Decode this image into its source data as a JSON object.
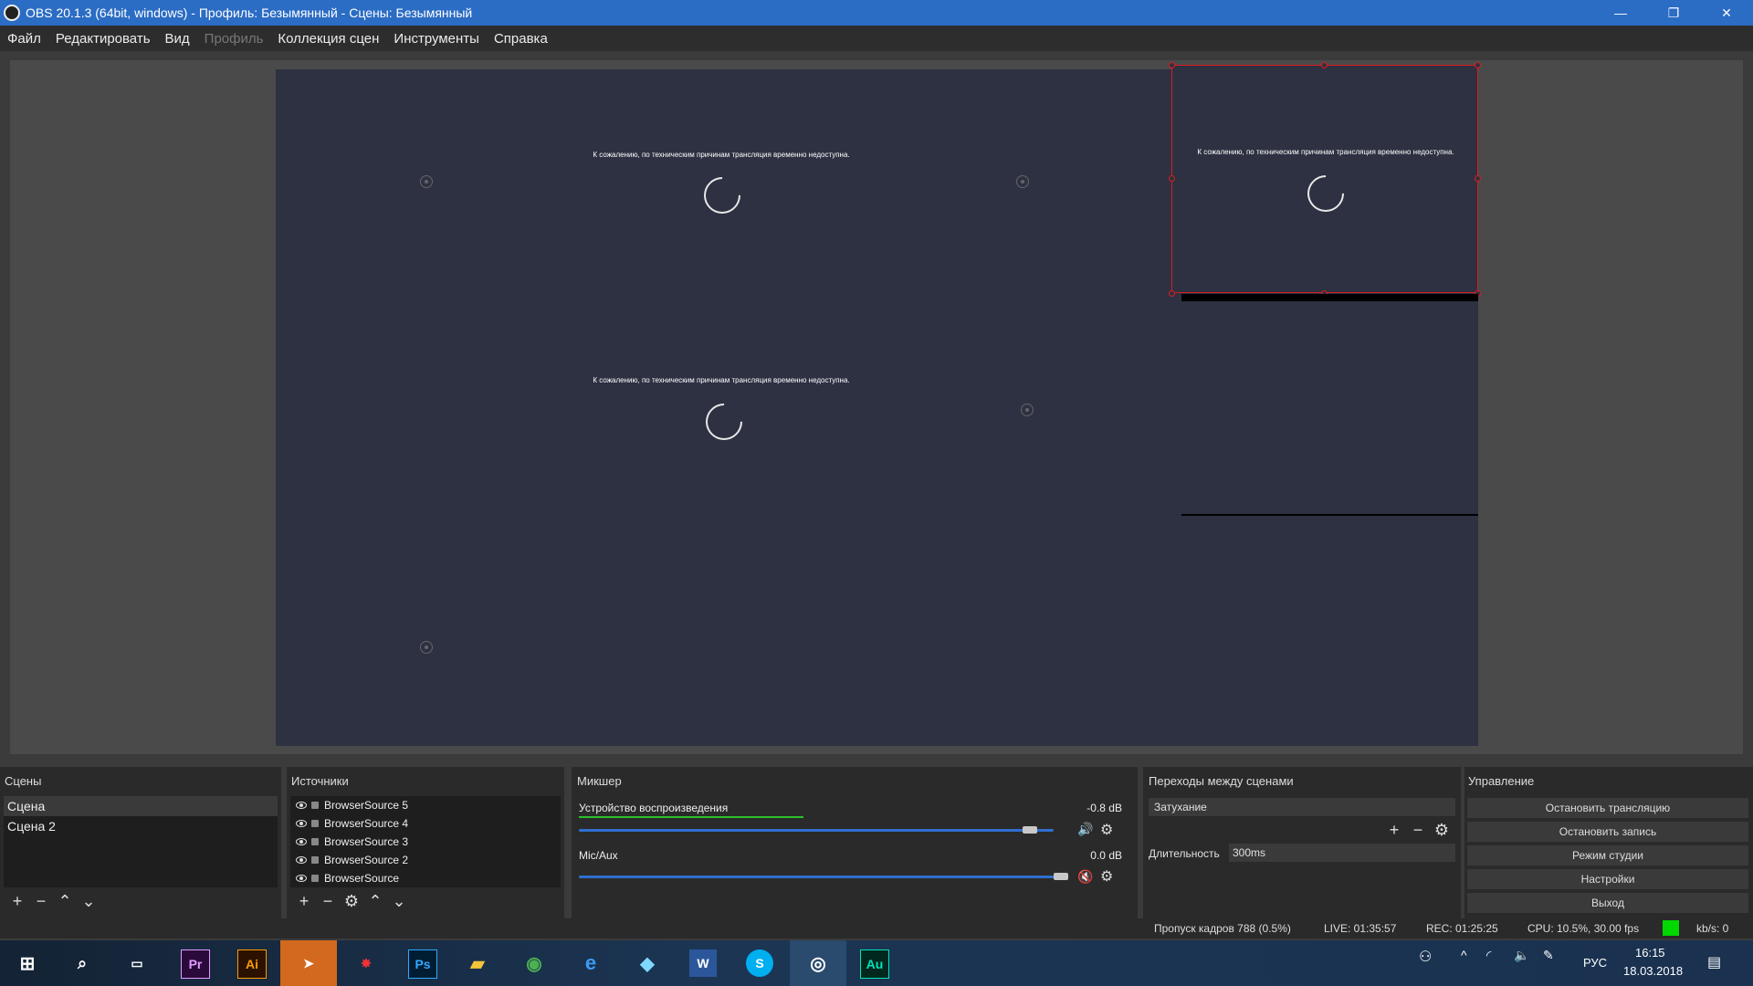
{
  "titlebar": {
    "title": "OBS 20.1.3 (64bit, windows) - Профиль: Безымянный - Сцены: Безымянный",
    "minimize": "—",
    "maximize": "❐",
    "close": "✕"
  },
  "menu": [
    "Файл",
    "Редактировать",
    "Вид",
    "Профиль",
    "Коллекция сцен",
    "Инструменты",
    "Справка"
  ],
  "preview": {
    "caption_1": "К сожалению, по техническим причинам трансляция временно недоступна.",
    "caption_2": "К сожалению, по техническим причинам трансляция временно недоступна.",
    "caption_3": "К сожалению, по техническим причинам трансляция временно недоступна."
  },
  "scenes": {
    "header": "Сцены",
    "items": [
      "Сцена",
      "Сцена 2"
    ]
  },
  "sources": {
    "header": "Источники",
    "items": [
      "BrowserSource 5",
      "BrowserSource 4",
      "BrowserSource 3",
      "BrowserSource 2",
      "BrowserSource"
    ]
  },
  "mixer": {
    "header": "Микшер",
    "channels": [
      {
        "name": "Устройство воспроизведения",
        "db": "-0.8 dB",
        "level": 0.95
      },
      {
        "name": "Mic/Aux",
        "db": "0.0 dB",
        "level": 1.0
      }
    ]
  },
  "transitions": {
    "header": "Переходы между сценами",
    "selected": "Затухание",
    "duration_label": "Длительность",
    "duration": "300ms"
  },
  "controls": {
    "header": "Управление",
    "buttons": [
      "Остановить трансляцию",
      "Остановить запись",
      "Режим студии",
      "Настройки",
      "Выход"
    ]
  },
  "status": {
    "dropped": "Пропуск кадров 788 (0.5%)",
    "live": "LIVE: 01:35:57",
    "rec": "REC: 01:25:25",
    "cpu": "CPU: 10.5%, 30.00 fps",
    "kbs": "kb/s: 0",
    "indicator_color": "#00d800"
  },
  "taskbar": {
    "apps": [
      "Pr",
      "Ai",
      "Ps",
      "W",
      "S",
      "Au"
    ],
    "lang": "РУС",
    "time": "16:15",
    "date": "18.03.2018"
  }
}
